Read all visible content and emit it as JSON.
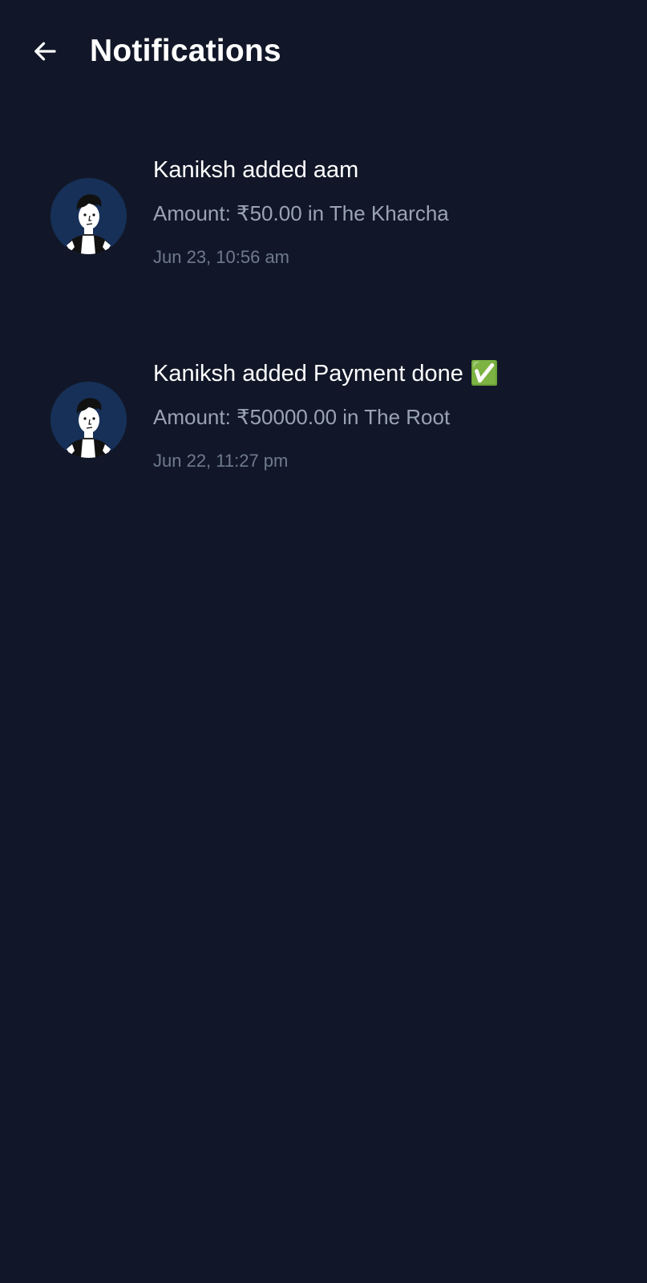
{
  "header": {
    "title": "Notifications",
    "back_icon": "arrow-left-icon"
  },
  "colors": {
    "background": "#111728",
    "avatar_background": "#173058",
    "primary_text": "#ffffff",
    "secondary_text": "#9aa3b3",
    "timestamp_text": "#6f7a8c"
  },
  "notifications": [
    {
      "title": "Kaniksh added aam",
      "detail": "Amount: ₹50.00 in The Kharcha",
      "time": "Jun 23, 10:56 am",
      "avatar_icon": "user-avatar-icon"
    },
    {
      "title": "Kaniksh added Payment done ✅",
      "detail": "Amount: ₹50000.00 in The Root",
      "time": "Jun 22, 11:27 pm",
      "avatar_icon": "user-avatar-icon"
    }
  ]
}
